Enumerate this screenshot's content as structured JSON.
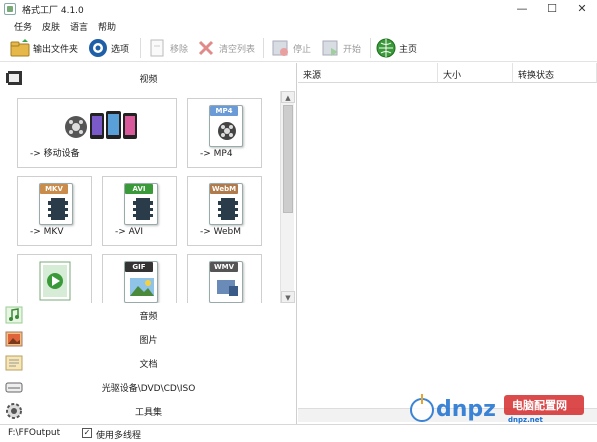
{
  "window": {
    "title": "格式工厂 4.1.0",
    "controls": {
      "minimize": "—",
      "maximize": "☐",
      "close": "✕"
    }
  },
  "menu": [
    "任务",
    "皮肤",
    "语言",
    "帮助"
  ],
  "toolbar": {
    "output_folder": "输出文件夹",
    "options": "选项",
    "remove": "移除",
    "clear_list": "清空列表",
    "stop": "停止",
    "start": "开始",
    "home": "主页"
  },
  "categories": {
    "video": "视频",
    "audio": "音频",
    "image": "图片",
    "document": "文档",
    "disc": "光驱设备\\DVD\\CD\\ISO",
    "tools": "工具集"
  },
  "tiles": [
    {
      "label": "-> 移动设备"
    },
    {
      "label": "-> MP4",
      "tag": "MP4"
    },
    {
      "label": "-> MKV",
      "tag": "MKV"
    },
    {
      "label": "-> AVI",
      "tag": "AVI"
    },
    {
      "label": "-> WebM",
      "tag": "WebM"
    },
    {
      "label": "",
      "tag": ""
    },
    {
      "label": "",
      "tag": "GIF"
    },
    {
      "label": "",
      "tag": "WMV"
    }
  ],
  "task_list": {
    "columns": [
      "来源",
      "大小",
      "转换状态"
    ]
  },
  "statusbar": {
    "output_path": "F:\\FFOutput",
    "multithread_label": "使用多线程",
    "multithread_checked": true
  },
  "watermark": {
    "logo_text": "dnpz.net",
    "site_name": "电脑配置网"
  },
  "colors": {
    "mp4_tag": "#6b9bd6",
    "avi_tag": "#3a9a3a",
    "mkv_tag": "#c98c4a",
    "gif_tag": "#333333",
    "wmv_tag": "#555555",
    "watermark_blue": "#1b6fd0",
    "watermark_red": "#d62b2b"
  }
}
